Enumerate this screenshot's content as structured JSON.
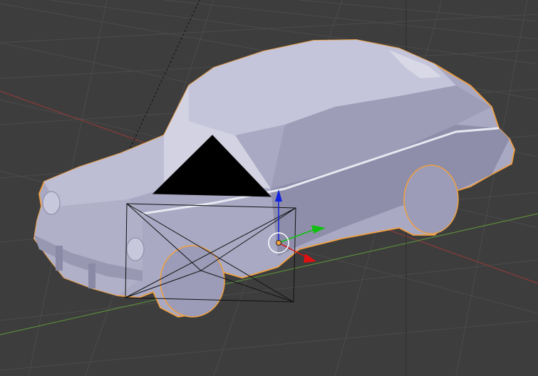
{
  "viewport": {
    "mode": "3d-viewport",
    "colors": {
      "background": "#3d3d3d",
      "grid": "#4a4a4a",
      "x_axis": "#8b3a3a",
      "y_axis": "#5a8a3a",
      "mesh": "#a8a8c4",
      "selection_outline": "#f0a040",
      "gizmo_x": "#e01010",
      "gizmo_y": "#10c010",
      "gizmo_z": "#1020e0"
    }
  },
  "objects": [
    {
      "name": "car-mesh",
      "selected": true
    },
    {
      "name": "camera",
      "selected": false
    }
  ],
  "gizmo": {
    "icons": [
      "translate-x-arrow-icon",
      "translate-y-arrow-icon",
      "translate-z-arrow-icon",
      "pivot-point-icon"
    ]
  }
}
